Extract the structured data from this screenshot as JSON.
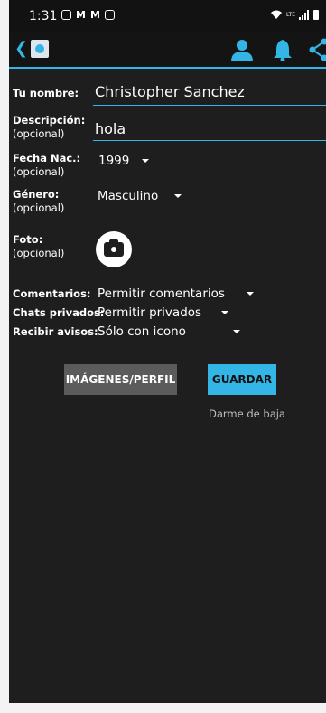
{
  "status_bar": {
    "time": "1:31",
    "lte_label": "LTE"
  },
  "form": {
    "name_label": "Tu nombre:",
    "name_value": "Christopher Sanchez",
    "desc_label": "Descripción:",
    "desc_optional": "(opcional)",
    "desc_value": "hola",
    "birth_label": "Fecha Nac.:",
    "birth_optional": "(opcional)",
    "birth_value": "1999",
    "gender_label": "Género:",
    "gender_optional": "(opcional)",
    "gender_value": "Masculino",
    "photo_label": "Foto:",
    "photo_optional": "(opcional)"
  },
  "settings": {
    "comments_label": "Comentarios:",
    "comments_value": "Permitir comentarios",
    "private_label": "Chats privados:",
    "private_value": "Permitir privados",
    "notify_label": "Recibir avisos:",
    "notify_value": "Sólo con icono"
  },
  "actions": {
    "images_button": "IMÁGENES/PERFIL",
    "save_button": "GUARDAR",
    "unsubscribe_link": "Darme de baja"
  },
  "colors": {
    "accent": "#33b5e5",
    "background": "#1e1e1e"
  }
}
